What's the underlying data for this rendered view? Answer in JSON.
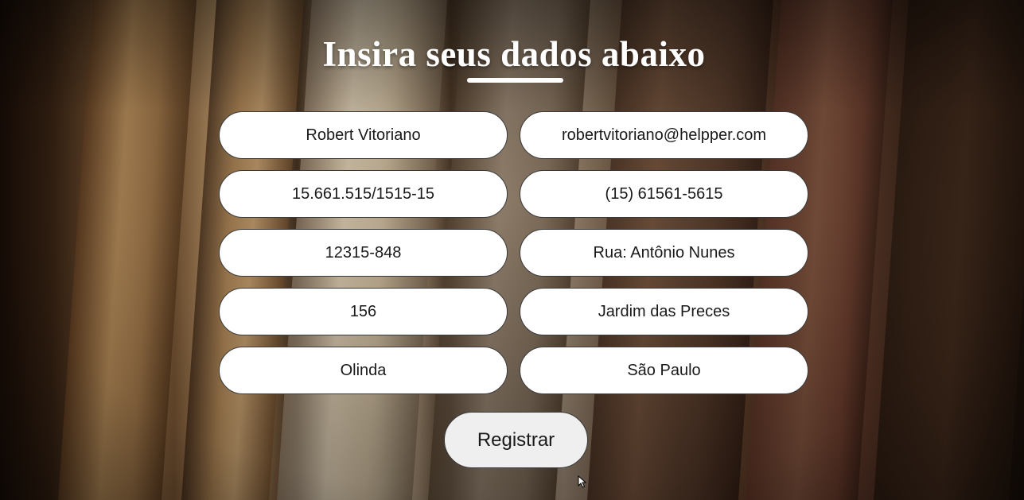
{
  "page": {
    "title": "Insira seus dados abaixo"
  },
  "form": {
    "fields": [
      {
        "value": "Robert Vitoriano"
      },
      {
        "value": "robertvitoriano@helpper.com"
      },
      {
        "value": "15.661.515/1515-15"
      },
      {
        "value": "(15) 61561-5615"
      },
      {
        "value": "12315-848"
      },
      {
        "value": "Rua: Antônio Nunes"
      },
      {
        "value": "156"
      },
      {
        "value": "Jardim das Preces"
      },
      {
        "value": "Olinda"
      },
      {
        "value": "São Paulo"
      }
    ],
    "submit_label": "Registrar"
  },
  "colors": {
    "title": "#ffffff",
    "field_background": "#ffffff",
    "button_background": "#efefef",
    "border": "#3a3a3a"
  },
  "icons": {
    "cursor": "mouse-pointer-icon"
  }
}
